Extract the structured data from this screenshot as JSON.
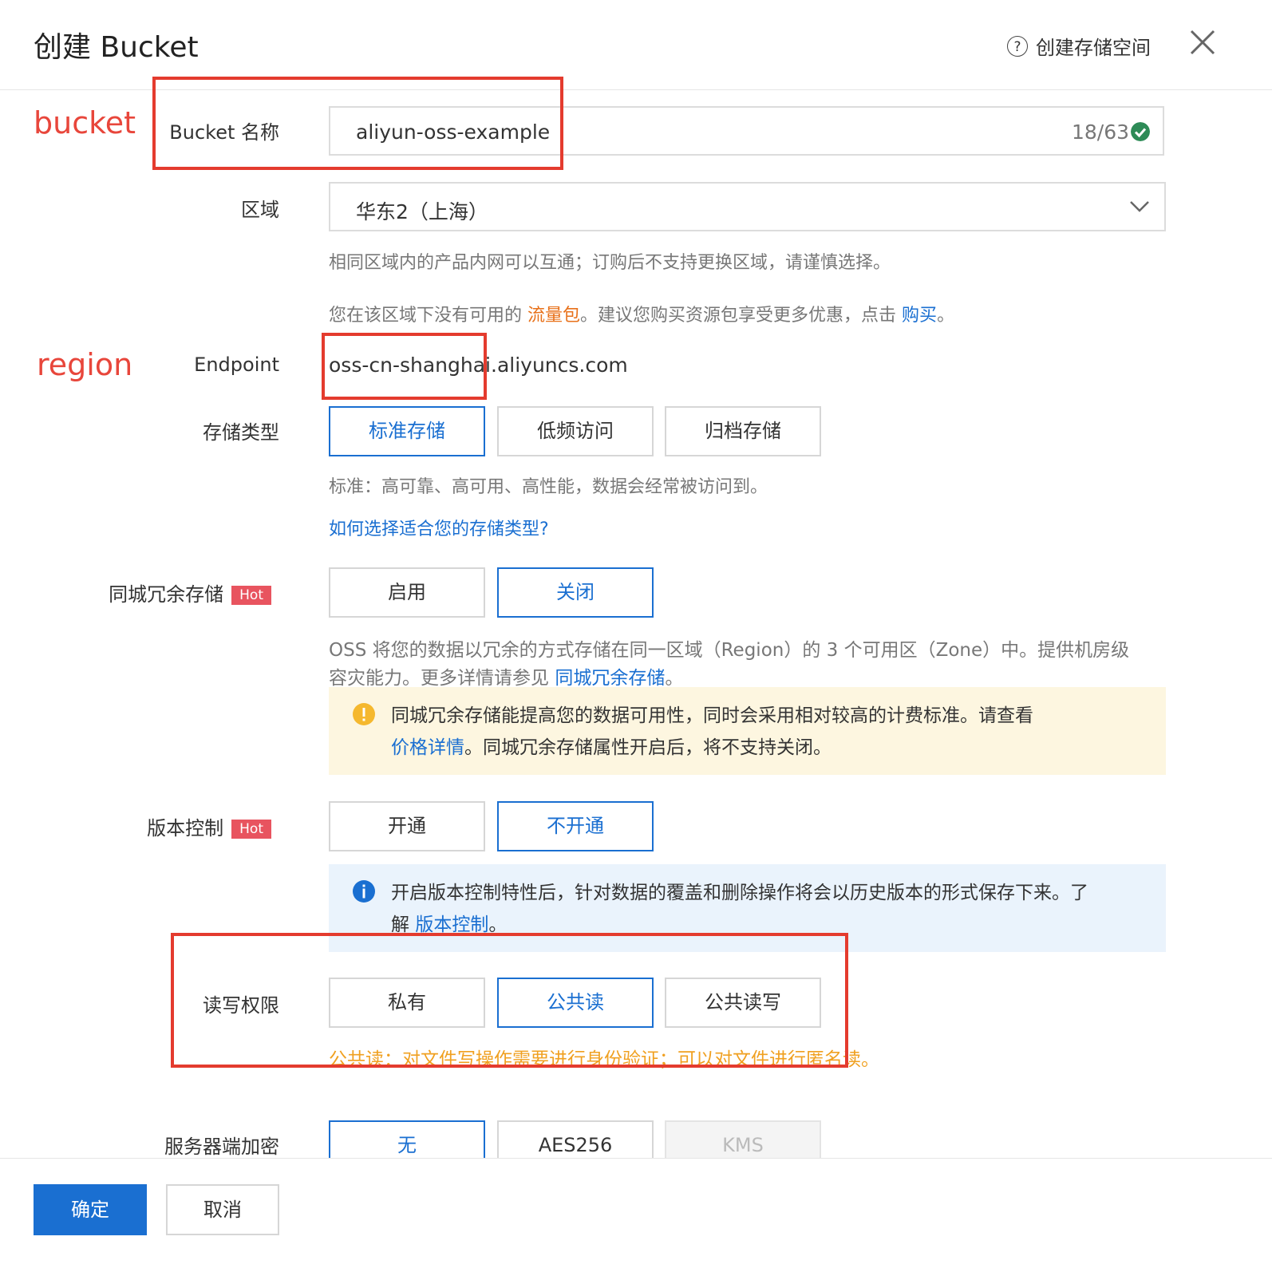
{
  "dialog": {
    "title": "创建 Bucket",
    "help_label": "创建存储空间"
  },
  "annotations": {
    "bucket": "bucket",
    "region": "region"
  },
  "bucket_name": {
    "label": "Bucket 名称",
    "value": "aliyun-oss-example",
    "counter": "18/63"
  },
  "region": {
    "label": "区域",
    "selected": "华东2（上海）",
    "hint": "相同区域内的产品内网可以互通；订购后不支持更换区域，请谨慎选择。",
    "promo_prefix": "您在该区域下没有可用的",
    "promo_link": "流量包",
    "promo_middle": "。建议您购买资源包享受更多优惠，点击",
    "promo_buy": "购买",
    "promo_suffix": "。"
  },
  "endpoint": {
    "label": "Endpoint",
    "value": "oss-cn-shanghai.aliyuncs.com"
  },
  "storage_class": {
    "label": "存储类型",
    "options": [
      "标准存储",
      "低频访问",
      "归档存储"
    ],
    "selected_index": 0,
    "hint": "标准：高可靠、高可用、高性能，数据会经常被访问到。",
    "help_link": "如何选择适合您的存储类型?"
  },
  "zrs": {
    "label": "同城冗余存储",
    "badge": "Hot",
    "options": [
      "启用",
      "关闭"
    ],
    "selected_index": 1,
    "hint_line1": "OSS 将您的数据以冗余的方式存储在同一区域（Region）的 3 个可用区（Zone）中。提供机房级",
    "hint_line2_prefix": "容灾能力。更多详情请参见",
    "hint_link": "同城冗余存储",
    "hint_suffix": "。",
    "warning_line1": "同城冗余存储能提高您的数据可用性，同时会采用相对较高的计费标准。请查看",
    "warning_link": "价格详情",
    "warning_line2": "。同城冗余存储属性开启后，将不支持关闭。"
  },
  "versioning": {
    "label": "版本控制",
    "badge": "Hot",
    "options": [
      "开通",
      "不开通"
    ],
    "selected_index": 1,
    "info_line1": "开启版本控制特性后，针对数据的覆盖和删除操作将会以历史版本的形式保存下来。了",
    "info_line2_prefix": "解",
    "info_link": "版本控制",
    "info_suffix": "。"
  },
  "acl": {
    "label": "读写权限",
    "options": [
      "私有",
      "公共读",
      "公共读写"
    ],
    "selected_index": 1,
    "warning": "公共读：对文件写操作需要进行身份验证；可以对文件进行匿名读。"
  },
  "encryption": {
    "label": "服务器端加密",
    "options": [
      "无",
      "AES256",
      "KMS"
    ],
    "selected_index": 0
  },
  "footer": {
    "confirm": "确定",
    "cancel": "取消"
  },
  "colors": {
    "primary": "#1a6fd1",
    "annotation_red": "#e43b2e",
    "hot_badge": "#e8545f",
    "warning_bg": "#fdf6e0",
    "info_bg": "#eaf3fc"
  }
}
